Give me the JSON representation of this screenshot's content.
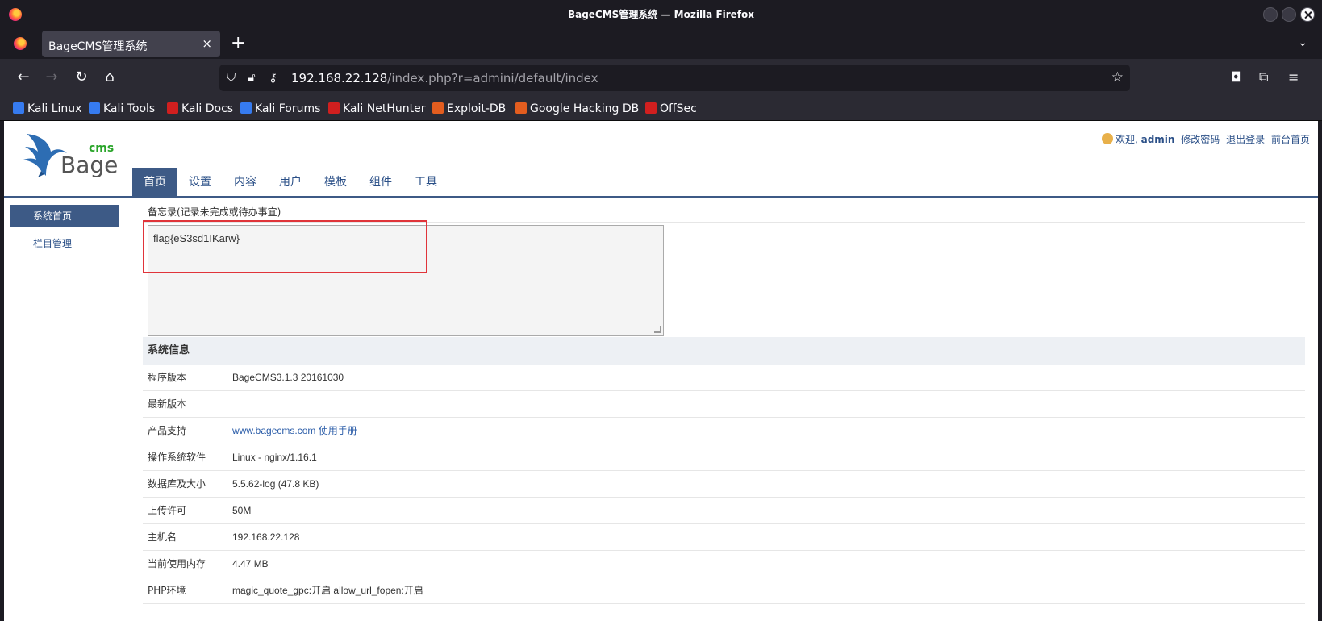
{
  "window": {
    "title": "BageCMS管理系统 — Mozilla Firefox"
  },
  "tabs": [
    {
      "label": "BageCMS管理系统",
      "close": "×"
    }
  ],
  "new_tab_symbol": "+",
  "tab_list_symbol": "⌄",
  "navbar": {
    "back": "←",
    "forward": "→",
    "reload": "↻",
    "home": "⌂",
    "url_host": "192.168.22.128",
    "url_path": "/index.php?r=admini/default/index",
    "bookmark_star": "☆",
    "pocket": "◘",
    "extensions": "⧉",
    "menu": "≡"
  },
  "bookmarks": [
    {
      "label": "Kali Linux",
      "color": "#367bf0"
    },
    {
      "label": "Kali Tools",
      "color": "#367bf0"
    },
    {
      "label": "Kali Docs",
      "color": "#d11f1f"
    },
    {
      "label": "Kali Forums",
      "color": "#367bf0"
    },
    {
      "label": "Kali NetHunter",
      "color": "#d11f1f"
    },
    {
      "label": "Exploit-DB",
      "color": "#e35d1f"
    },
    {
      "label": "Google Hacking DB",
      "color": "#e35d1f"
    },
    {
      "label": "OffSec",
      "color": "#d11f1f"
    }
  ],
  "site": {
    "logo_text": "Bage",
    "logo_sup": "cms",
    "welcome": "欢迎,",
    "user": "admin",
    "links": [
      "修改密码",
      "退出登录",
      "前台首页"
    ],
    "nav": [
      "首页",
      "设置",
      "内容",
      "用户",
      "模板",
      "组件",
      "工具"
    ],
    "sidebar": [
      "系统首页",
      "栏目管理"
    ],
    "memo_label": "备忘录(记录未完成或待办事宜)",
    "memo_value": "flag{eS3sd1IKarw}",
    "info_title": "系统信息",
    "info_rows": [
      {
        "k": "程序版本",
        "v": "BageCMS3.1.3 20161030"
      },
      {
        "k": "最新版本",
        "v": ""
      },
      {
        "k": "产品支持",
        "v": "www.bagecms.com 使用手册"
      },
      {
        "k": "操作系统软件",
        "v": "Linux - nginx/1.16.1"
      },
      {
        "k": "数据库及大小",
        "v": "5.5.62-log (47.8 KB)"
      },
      {
        "k": "上传许可",
        "v": "50M"
      },
      {
        "k": "主机名",
        "v": "192.168.22.128"
      },
      {
        "k": "当前使用内存",
        "v": "4.47 MB"
      },
      {
        "k": "PHP环境",
        "v": "magic_quote_gpc:开启 allow_url_fopen:开启"
      }
    ]
  }
}
